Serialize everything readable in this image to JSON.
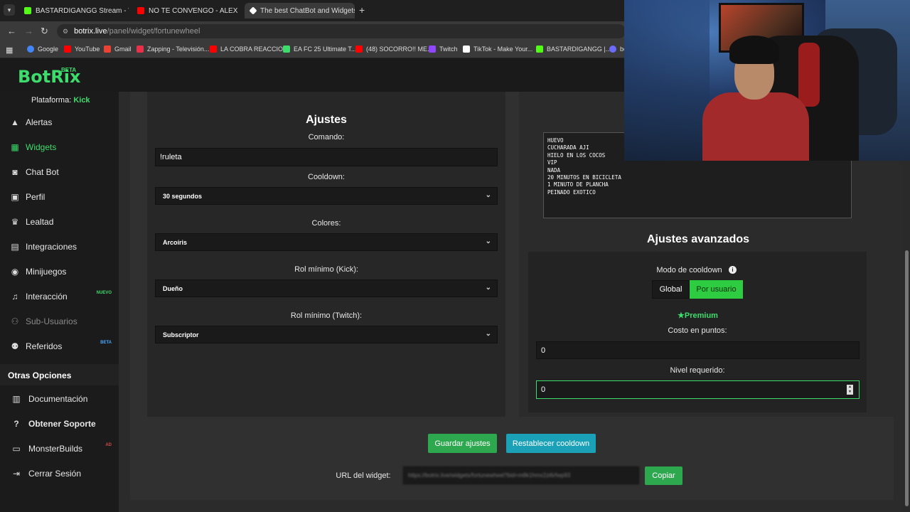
{
  "browser": {
    "tabs": [
      {
        "title": "BASTARDIGANGG Stream - Wa",
        "color": "#53fc18"
      },
      {
        "title": "NO TE CONVENGO - ALEX",
        "color": "#ff0000"
      },
      {
        "title": "The best ChatBot and Widgets",
        "color": "#ffffff"
      }
    ],
    "new_tab": "+",
    "url_host": "botrix.live",
    "url_path": "/panel/widget/fortunewheel",
    "bookmarks": [
      {
        "label": "Google",
        "color": "#4285f4"
      },
      {
        "label": "YouTube",
        "color": "#ff0000"
      },
      {
        "label": "Gmail",
        "color": "#ea4335"
      },
      {
        "label": "Zapping - Televisión...",
        "color": "#e8304a"
      },
      {
        "label": "LA COBRA REACCIO...",
        "color": "#ff0000"
      },
      {
        "label": "EA FC 25 Ultimate T...",
        "color": "#3ddc6d"
      },
      {
        "label": "(48) SOCORRO!! ME...",
        "color": "#ff0000"
      },
      {
        "label": "Twitch",
        "color": "#9146ff"
      },
      {
        "label": "TikTok - Make Your...",
        "color": "#ffffff"
      },
      {
        "label": "BASTARDIGANGG |...",
        "color": "#53fc18"
      },
      {
        "label": "be",
        "color": "#6b6bff"
      }
    ]
  },
  "app": {
    "logo": "BotRix",
    "logo_badge": "BETA",
    "platform_label": "Plataforma:",
    "platform_value": "Kick",
    "accent": "#3ddc6d"
  },
  "sidebar": {
    "items": [
      {
        "label": "Alertas",
        "icon": "warning-icon"
      },
      {
        "label": "Widgets",
        "icon": "grid-icon",
        "active": true
      },
      {
        "label": "Chat Bot",
        "icon": "robot-icon"
      },
      {
        "label": "Perfil",
        "icon": "id-card-icon"
      },
      {
        "label": "Lealtad",
        "icon": "trophy-icon"
      },
      {
        "label": "Integraciones",
        "icon": "plug-icon"
      },
      {
        "label": "Minijuegos",
        "icon": "gamepad-icon"
      },
      {
        "label": "Interacción",
        "icon": "music-icon",
        "badge": "NUEVO"
      },
      {
        "label": "Sub-Usuarios",
        "icon": "users-icon",
        "muted": true
      },
      {
        "label": "Referidos",
        "icon": "user-group-icon",
        "badge": "BETA"
      }
    ],
    "other_title": "Otras Opciones",
    "other_items": [
      {
        "label": "Documentación",
        "icon": "document-icon"
      },
      {
        "label": "Obtener Soporte",
        "icon": "question-icon"
      },
      {
        "label": "MonsterBuilds",
        "icon": "laptop-icon",
        "badge": "AD"
      },
      {
        "label": "Cerrar Sesión",
        "icon": "logout-icon"
      }
    ]
  },
  "settings": {
    "title": "Ajustes",
    "command_label": "Comando:",
    "command_value": "!ruleta",
    "cooldown_label": "Cooldown:",
    "cooldown_value": "30 segundos",
    "colors_label": "Colores:",
    "colors_value": "Arcoíris",
    "role_kick_label": "Rol mínimo (Kick):",
    "role_kick_value": "Dueño",
    "role_twitch_label": "Rol mínimo (Twitch):",
    "role_twitch_value": "Subscriptor"
  },
  "wheel": {
    "options_text": "HUEVO\nCUCHARADA AJI\nHIELO EN LOS COCOS\nVIP\nNADA\n20 MINUTOS EN BICICLETA\n1 MINUTO DE PLANCHA\nPEINADO EXOTICO"
  },
  "advanced": {
    "title": "Ajustes avanzados",
    "cooldown_mode_label": "Modo de cooldown",
    "mode_global": "Global",
    "mode_per_user": "Por usuario",
    "premium": "Premium",
    "cost_label": "Costo en puntos:",
    "cost_value": "0",
    "level_label": "Nivel requerido:",
    "level_value": "0"
  },
  "actions": {
    "save": "Guardar ajustes",
    "reset": "Restablecer cooldown",
    "widget_url_label": "URL del widget:",
    "widget_url_value": "https://botrix.live/widgets/fortunewheel?bid=m8k1hmx2zi6rfwp93",
    "copy": "Copiar"
  }
}
